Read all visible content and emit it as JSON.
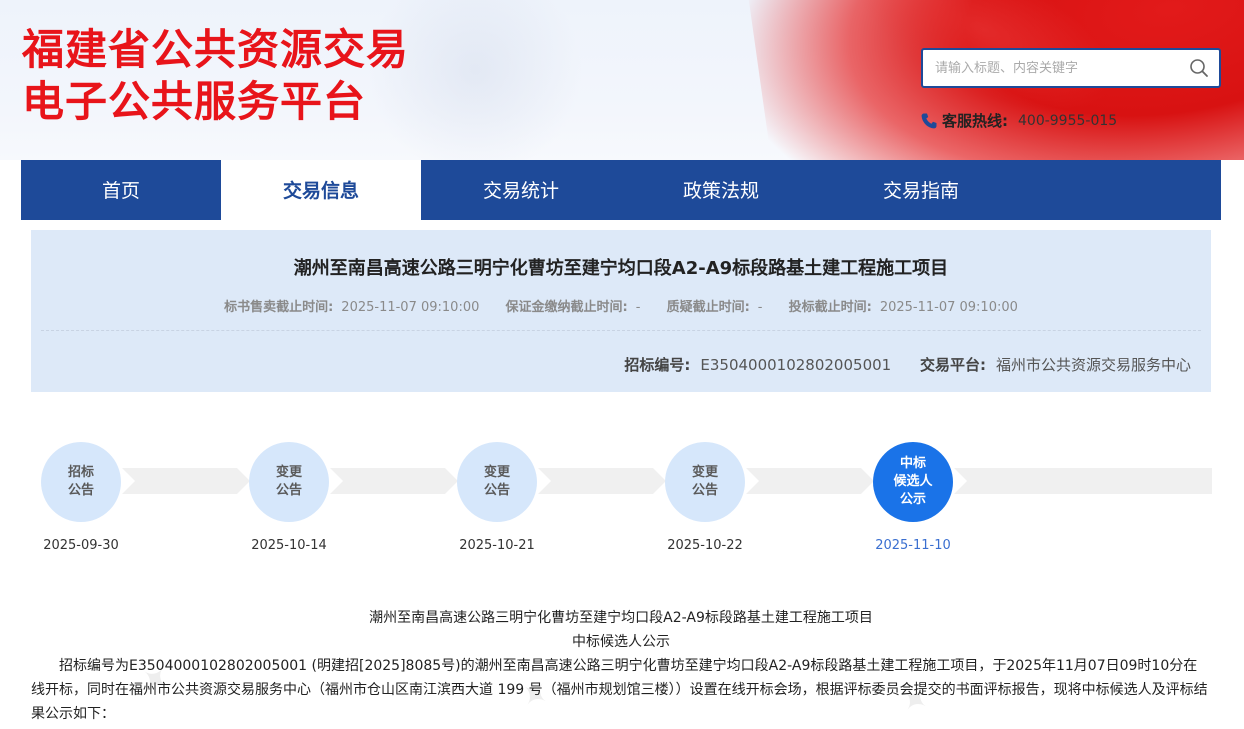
{
  "header": {
    "title_line1": "福建省公共资源交易",
    "title_line2": "电子公共服务平台",
    "search_placeholder": "请输入标题、内容关键字",
    "hotline_label": "客服热线:",
    "hotline_number": "400-9955-015",
    "brand_color": "#e8141a"
  },
  "nav": {
    "items": [
      {
        "label": "首页"
      },
      {
        "label": "交易信息",
        "active": true
      },
      {
        "label": "交易统计"
      },
      {
        "label": "政策法规"
      },
      {
        "label": "交易指南"
      }
    ],
    "bg_color": "#1e4a99"
  },
  "project": {
    "title": "潮州至南昌高速公路三明宁化曹坊至建宁均口段A2-A9标段路基土建工程施工项目",
    "deadlines": [
      {
        "label": "标书售卖截止时间:",
        "value": "2025-11-07 09:10:00"
      },
      {
        "label": "保证金缴纳截止时间:",
        "value": "-"
      },
      {
        "label": "质疑截止时间:",
        "value": "-"
      },
      {
        "label": "投标截止时间:",
        "value": "2025-11-07 09:10:00"
      }
    ],
    "bid_no_label": "招标编号:",
    "bid_no": "E3504000102802005001",
    "platform_label": "交易平台:",
    "platform": "福州市公共资源交易服务中心"
  },
  "timeline": {
    "steps": [
      {
        "line1": "招标",
        "line2": "公告",
        "line3": "",
        "date": "2025-09-30",
        "active": false
      },
      {
        "line1": "变更",
        "line2": "公告",
        "line3": "",
        "date": "2025-10-14",
        "active": false
      },
      {
        "line1": "变更",
        "line2": "公告",
        "line3": "",
        "date": "2025-10-21",
        "active": false
      },
      {
        "line1": "变更",
        "line2": "公告",
        "line3": "",
        "date": "2025-10-22",
        "active": false
      },
      {
        "line1": "中标",
        "line2": "候选人",
        "line3": "公示",
        "date": "2025-11-10",
        "active": true
      }
    ],
    "active_color": "#1a73e8"
  },
  "content": {
    "heading1": "潮州至南昌高速公路三明宁化曹坊至建宁均口段A2-A9标段路基土建工程施工项目",
    "heading2": "中标候选人公示",
    "paragraph": "招标编号为E3504000102802005001 (明建招[2025]8085号)的潮州至南昌高速公路三明宁化曹坊至建宁均口段A2-A9标段路基土建工程施工项目，于2025年11月07日09时10分在线开标，同时在福州市公共资源交易服务中心（福州市仓山区南江滨西大道 199 号（福州市规划馆三楼））设置在线开标会场，根据评标委员会提交的书面评标报告，现将中标候选人及评标结果公示如下："
  }
}
